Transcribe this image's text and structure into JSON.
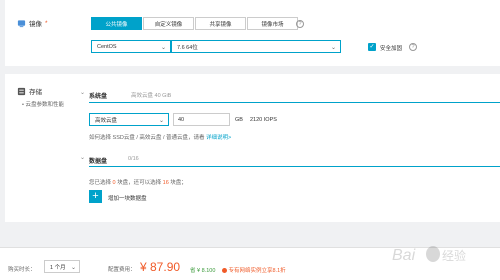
{
  "image_section": {
    "title": "镜像",
    "required_mark": "*",
    "tabs": [
      {
        "label": "公共镜像",
        "active": true
      },
      {
        "label": "自定义镜像",
        "active": false
      },
      {
        "label": "共享镜像",
        "active": false
      },
      {
        "label": "镜像市场",
        "active": false
      }
    ],
    "os_select": "CentOS",
    "version_select": "7.6 64位",
    "security_hardening": {
      "label": "安全加固",
      "checked": true
    }
  },
  "storage_section": {
    "title": "存储",
    "subtitle": "• 云盘参数和性能",
    "system_disk": {
      "label": "系统盘",
      "hint": "高效云盘  40 GiB",
      "type_select": "高效云盘",
      "size_value": "40",
      "unit": "GB",
      "iops": "2120 IOPS",
      "desc_prefix": "如何选择 SSD云盘 / 高效云盘 / 普通云盘，请看 ",
      "desc_link": "详细说明>"
    },
    "data_disk": {
      "label": "数据盘",
      "count": "0/16",
      "status_p1": "您已选择 ",
      "selected": "0",
      "status_p2": " 块盘，还可以选择 ",
      "remaining": "16",
      "status_p3": " 块盘；",
      "add_label": "增加一块数据盘"
    }
  },
  "footer": {
    "duration_label": "购买时长：",
    "duration_value": "1 个月",
    "fee_label": "配置费用：",
    "price": "¥ 87.90",
    "saved_prefix": "省 ¥ ",
    "saved_amount": "8.100",
    "promo": "专有网络实例立享8.1折"
  },
  "colors": {
    "accent": "#00a2ca",
    "price": "#f05a28"
  }
}
